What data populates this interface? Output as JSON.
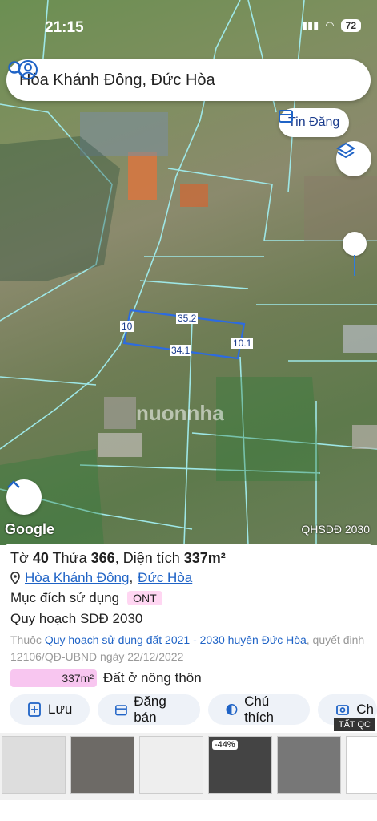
{
  "status": {
    "time": "21:15",
    "battery": "72"
  },
  "search": {
    "query": "Hòa Khánh Đông, Đức Hòa"
  },
  "map": {
    "tin_dang_label": "Tin Đăng",
    "google_label": "Google",
    "layer_label": "QHSDĐ 2030",
    "watermark": "nuonnha",
    "dimensions": {
      "top": "35.2",
      "left": "10",
      "bottom": "34.1",
      "right": "10.1"
    }
  },
  "panel": {
    "to_label": "Tờ",
    "to_value": "40",
    "thua_label": "Thửa",
    "thua_value": "366",
    "area_label": ", Diện tích",
    "area_value": "337m²",
    "location": {
      "ward": "Hòa Khánh Đông",
      "sep": ",",
      "district": "Đức Hòa"
    },
    "purpose_label": "Mục đích sử dụng",
    "purpose_code": "ONT",
    "plan_title": "Quy hoạch SDĐ 2030",
    "desc_prefix": "Thuộc",
    "desc_link": "Quy hoạch sử dụng đất 2021 - 2030 huyện Đức Hòa",
    "desc_suffix": ", quyết định 12106/QĐ-UBND ngày 22/12/2022",
    "area_chip": "337m²",
    "area_type": "Đất ở nông thôn",
    "actions": {
      "save": "Lưu",
      "post": "Đăng bán",
      "share": "Chú thích",
      "more": "Ch"
    },
    "ads_label": "TẤT QC",
    "ad_discount": "-44%"
  },
  "colors": {
    "accent": "#1f63c6",
    "chip_pink": "#f8c6f0"
  }
}
